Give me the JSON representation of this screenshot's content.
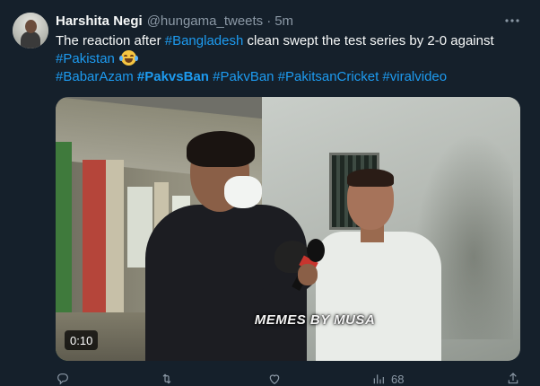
{
  "tweet": {
    "author_name": "Harshita Negi",
    "handle": "@hungama_tweets",
    "separator": "·",
    "time": "5m",
    "text_plain_1": "The reaction after ",
    "tag_bangladesh": "#Bangladesh",
    "text_plain_2": " clean swept the test series by 2-0 against",
    "tag_pakistan": "#Pakistan",
    "emoji": "face-with-tears-of-joy",
    "hashtags": [
      "#BabarAzam",
      "#PakvsBan",
      "#PakvBan",
      "#PakitsanCricket",
      "#viralvideo"
    ]
  },
  "media": {
    "watermark": "MEMES BY MUSA",
    "duration": "0:10"
  },
  "actions": {
    "views_count": "68"
  },
  "colors": {
    "background": "#15202b",
    "text": "#f7f9f9",
    "secondary": "#8b98a5",
    "link": "#1d9bf0"
  }
}
